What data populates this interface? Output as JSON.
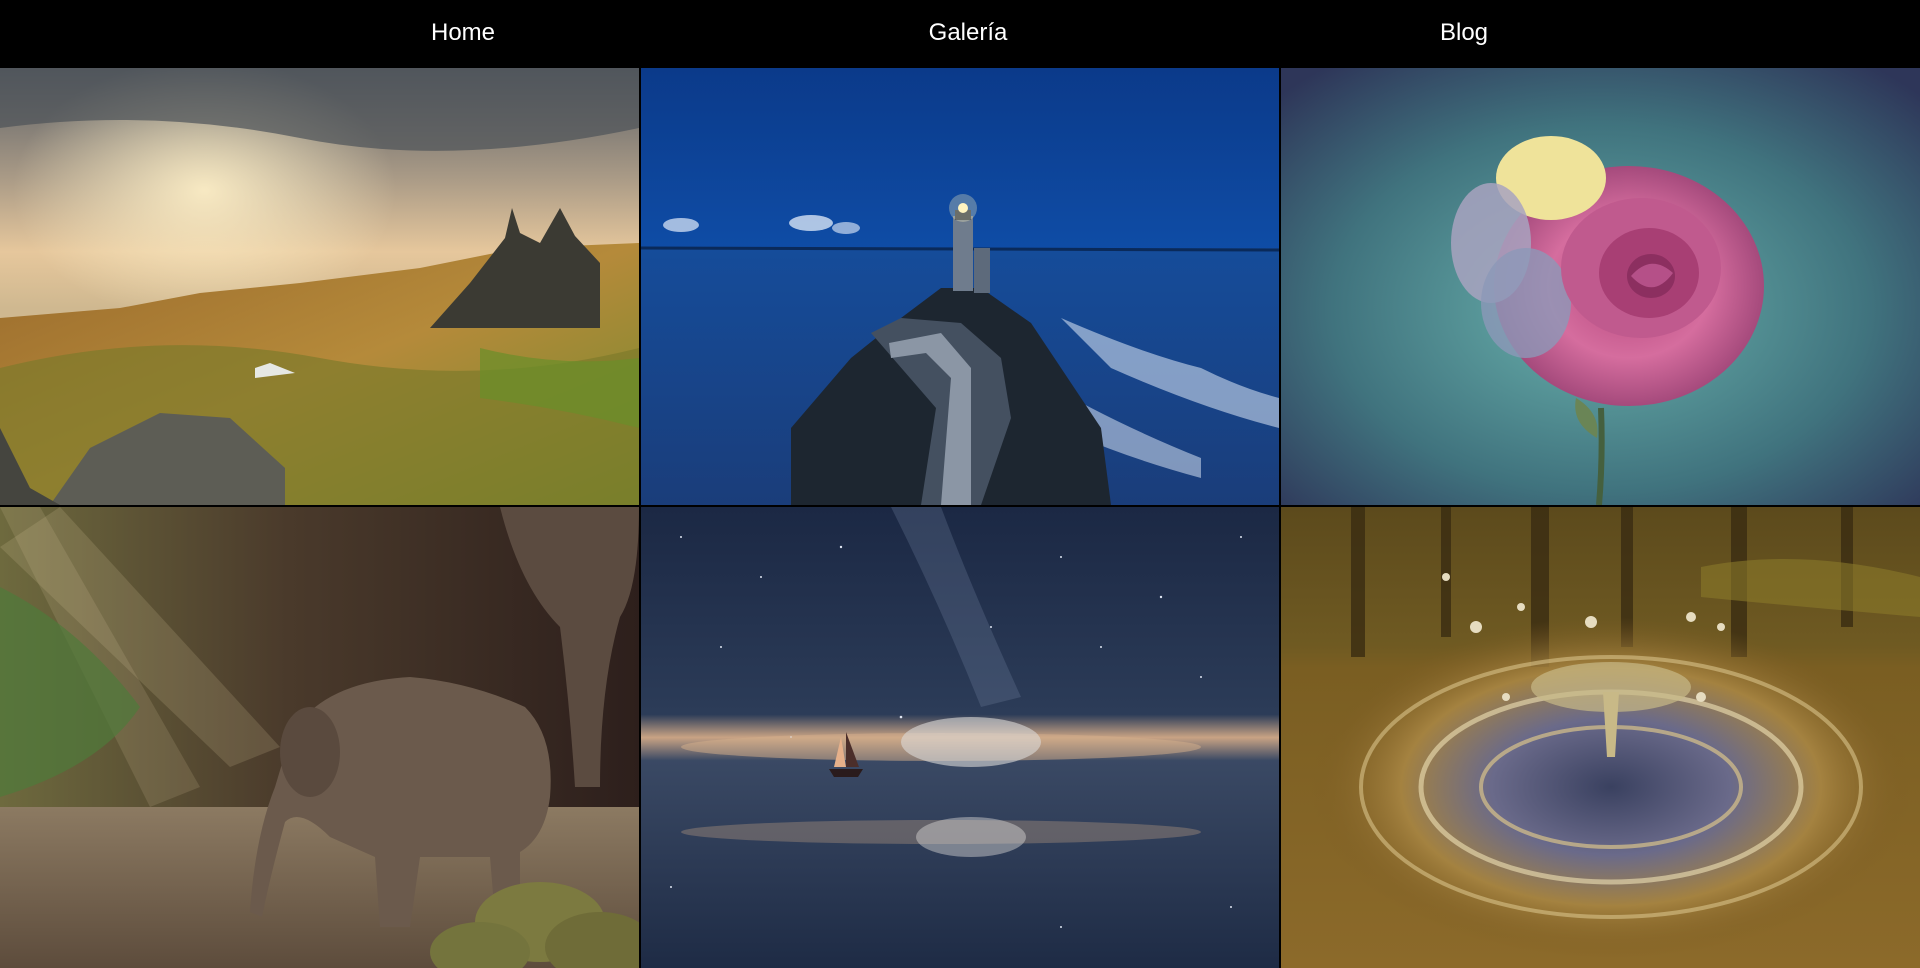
{
  "nav": {
    "home_label": "Home",
    "gallery_label": "Galería",
    "blog_label": "Blog"
  },
  "gallery": {
    "tiles": [
      {
        "subject": "mountain-landscape"
      },
      {
        "subject": "lighthouse"
      },
      {
        "subject": "rose"
      },
      {
        "subject": "elephants"
      },
      {
        "subject": "sailboat-milky-way"
      },
      {
        "subject": "water-drop-splash"
      }
    ]
  }
}
